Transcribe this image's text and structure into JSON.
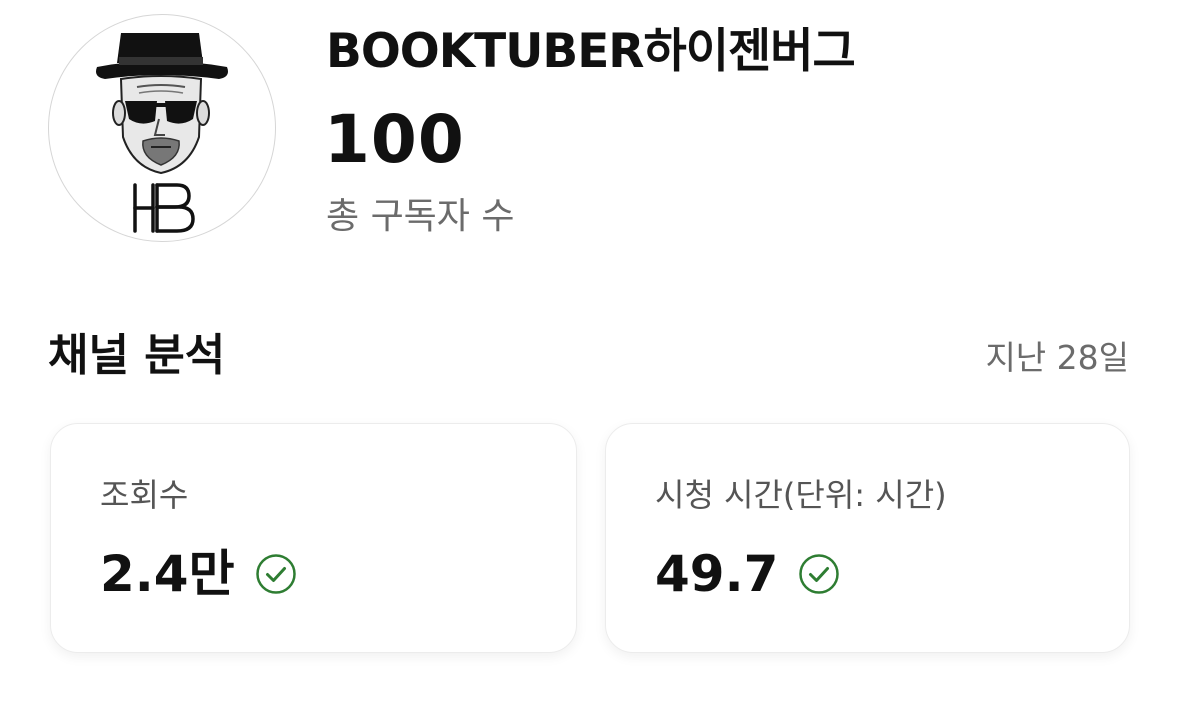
{
  "profile": {
    "channel_name": "BOOKTUBER하이젠버그",
    "subscriber_count": "100",
    "subscriber_label": "총 구독자 수",
    "avatar_initials": "HB"
  },
  "analytics": {
    "title": "채널 분석",
    "period": "지난 28일",
    "cards": [
      {
        "label": "조회수",
        "value": "2.4만",
        "status_icon": "check-circle-icon"
      },
      {
        "label": "시청 시간(단위: 시간)",
        "value": "49.7",
        "status_icon": "check-circle-icon"
      }
    ]
  },
  "colors": {
    "text_primary": "#111111",
    "text_secondary": "#6b6b6b",
    "check_green": "#2e7d32",
    "card_border": "#ececec"
  }
}
